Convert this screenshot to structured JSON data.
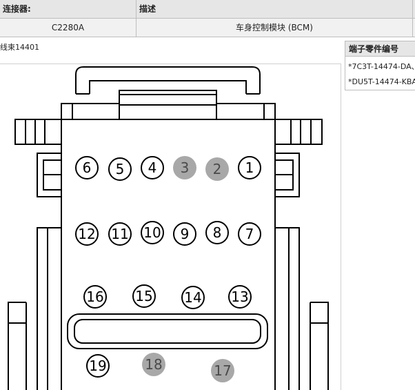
{
  "table": {
    "connector_header": "连接器:",
    "description_header": "描述",
    "connector_value": "C2280A",
    "description_value": "车身控制模块 (BCM)"
  },
  "harness_label": "线束14401",
  "terminal_panel": {
    "title": "端子零件编号",
    "parts": [
      "*7C3T-14474-DA、",
      "*DU5T-14474-KBA"
    ]
  },
  "colors": {
    "populated_pin": "#ffffff",
    "empty_pin": "#a8a8a8",
    "outline": "#000000"
  },
  "pins": [
    {
      "num": "1",
      "populated": true
    },
    {
      "num": "2",
      "populated": false
    },
    {
      "num": "3",
      "populated": false
    },
    {
      "num": "4",
      "populated": true
    },
    {
      "num": "5",
      "populated": true
    },
    {
      "num": "6",
      "populated": true
    },
    {
      "num": "7",
      "populated": true
    },
    {
      "num": "8",
      "populated": true
    },
    {
      "num": "9",
      "populated": true
    },
    {
      "num": "10",
      "populated": true
    },
    {
      "num": "11",
      "populated": true
    },
    {
      "num": "12",
      "populated": true
    },
    {
      "num": "13",
      "populated": true
    },
    {
      "num": "14",
      "populated": true
    },
    {
      "num": "15",
      "populated": true
    },
    {
      "num": "16",
      "populated": true
    },
    {
      "num": "17",
      "populated": false
    },
    {
      "num": "18",
      "populated": false
    },
    {
      "num": "19",
      "populated": true
    }
  ]
}
